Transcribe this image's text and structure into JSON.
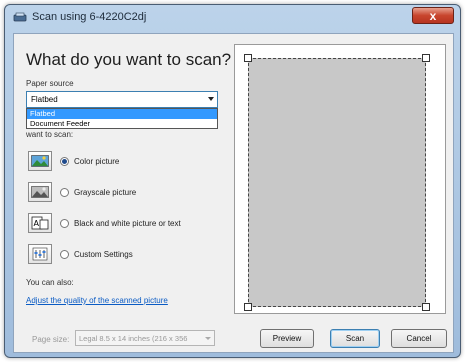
{
  "window": {
    "title": "Scan using 6-4220C2dj",
    "close_label": "x"
  },
  "main": {
    "heading": "What do you want to scan?",
    "paper_source_label": "Paper source",
    "paper_source_value": "Flatbed",
    "paper_source_options": [
      "Flatbed",
      "Document Feeder"
    ],
    "want_to_scan_label": "want to scan:",
    "options": [
      {
        "label": "Color picture",
        "selected": true,
        "icon": "color-picture-icon"
      },
      {
        "label": "Grayscale picture",
        "selected": false,
        "icon": "grayscale-picture-icon"
      },
      {
        "label": "Black and white picture or text",
        "selected": false,
        "icon": "black-white-text-icon"
      },
      {
        "label": "Custom Settings",
        "selected": false,
        "icon": "custom-settings-icon"
      }
    ],
    "also_label": "You can also:",
    "adjust_link": "Adjust the quality of the scanned picture",
    "page_size_label": "Page size:",
    "page_size_value": "Legal 8.5 x 14 inches (216 x 356"
  },
  "buttons": {
    "preview": "Preview",
    "scan": "Scan",
    "cancel": "Cancel"
  },
  "colors": {
    "accent": "#3399ff",
    "link": "#0a5bc4",
    "preview_area": "#c8c8c8"
  }
}
